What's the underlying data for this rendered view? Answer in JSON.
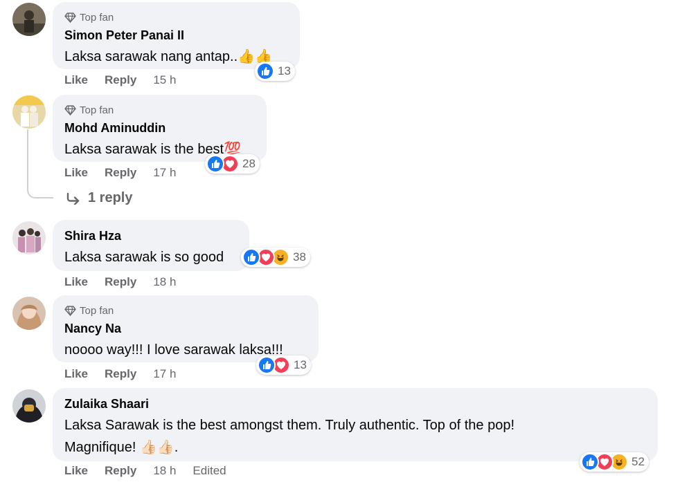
{
  "labels": {
    "top_fan": "Top fan",
    "like": "Like",
    "reply": "Reply",
    "edited": "Edited"
  },
  "icons": {
    "top_fan": "diamond-icon",
    "like": "like-reaction-icon",
    "love": "love-reaction-icon",
    "haha": "haha-reaction-icon",
    "reply_arrow": "reply-arrow-icon"
  },
  "colors": {
    "like": "#1877f2",
    "love": "#f33e58",
    "haha": "#f7b125",
    "bubble": "#f0f2f5",
    "secondary_text": "#65676b"
  },
  "comments": [
    {
      "author": "Simon Peter Panai II",
      "top_fan": true,
      "text": "Laksa sarawak nang antap..👍👍",
      "time": "15 h",
      "reaction_count": "13",
      "reactions": [
        "like"
      ]
    },
    {
      "author": "Mohd Aminuddin",
      "top_fan": true,
      "text": "Laksa sarawak is the best💯",
      "time": "17 h",
      "reaction_count": "28",
      "reactions": [
        "like",
        "love"
      ],
      "replies_label": "1 reply"
    },
    {
      "author": "Shira Hza",
      "top_fan": false,
      "text": "Laksa sarawak is so good",
      "time": "18 h",
      "reaction_count": "38",
      "reactions": [
        "like",
        "love",
        "haha"
      ]
    },
    {
      "author": "Nancy Na",
      "top_fan": true,
      "text": "noooo way!!! I love sarawak laksa!!!",
      "time": "17 h",
      "reaction_count": "13",
      "reactions": [
        "like",
        "love"
      ]
    },
    {
      "author": "Zulaika Shaari",
      "top_fan": false,
      "text_line1": "Laksa Sarawak is the best amongst them. Truly authentic. Top of the pop!",
      "text_line2": "Magnifique! 👍🏻👍🏻.",
      "time": "18 h",
      "edited": true,
      "reaction_count": "52",
      "reactions": [
        "like",
        "love",
        "haha"
      ]
    }
  ]
}
